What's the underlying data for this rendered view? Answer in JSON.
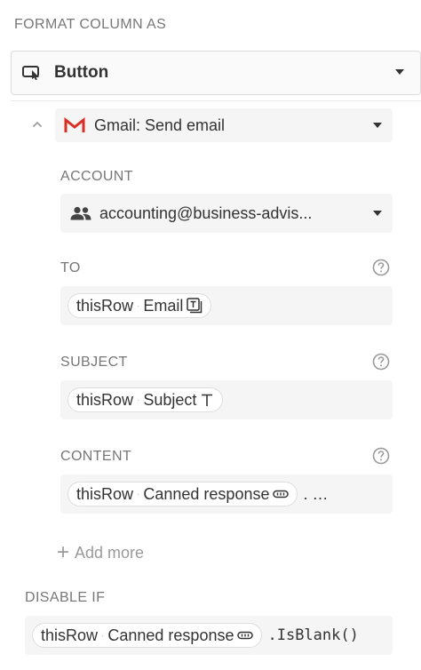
{
  "format_section": {
    "label": "FORMAT COLUMN AS",
    "selected": "Button",
    "icon": "button-cursor-icon"
  },
  "action": {
    "label": "Gmail: Send email",
    "icon": "gmail-icon",
    "brand_color": "#d93025"
  },
  "account": {
    "label": "ACCOUNT",
    "value": "accounting@business-advis...",
    "icon": "people-icon"
  },
  "to": {
    "label": "TO",
    "chip": {
      "ref": "thisRow",
      "column": "Email",
      "type_icon": "email-type-icon"
    }
  },
  "subject": {
    "label": "SUBJECT",
    "chip": {
      "ref": "thisRow",
      "column": "Subject",
      "type_icon": "text-type-icon"
    }
  },
  "content": {
    "label": "CONTENT",
    "chip": {
      "ref": "thisRow",
      "column": "Canned response",
      "type_icon": "select-type-icon"
    },
    "tail": ". …"
  },
  "add_more": {
    "label": "Add more"
  },
  "disable_if": {
    "label": "DISABLE IF",
    "chip": {
      "ref": "thisRow",
      "column": "Canned response",
      "type_icon": "select-type-icon"
    },
    "tail": ".IsBlank()"
  }
}
